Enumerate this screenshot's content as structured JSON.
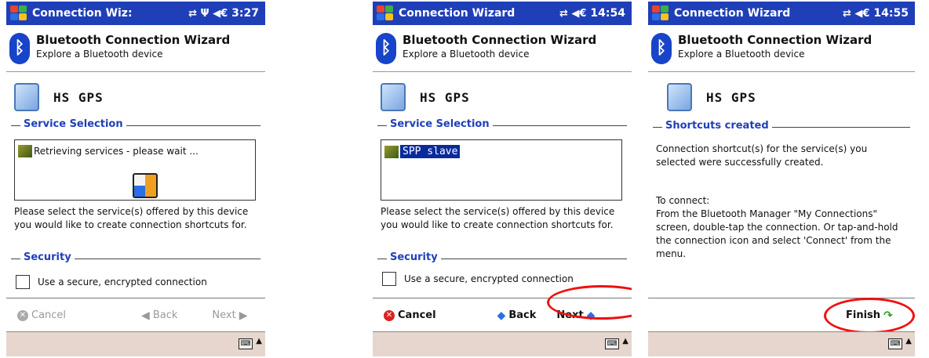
{
  "screens": [
    {
      "titlebar": {
        "title": "Connection Wiz:",
        "icons": "⇄ Ψ ◀€",
        "time": "3:27"
      },
      "header": {
        "title": "Bluetooth Connection Wizard",
        "subtitle": "Explore a Bluetooth device"
      },
      "device_name": "HS  GPS",
      "section1": "Service Selection",
      "list_text": "Retrieving services - please wait ...",
      "description": "Please select the service(s) offered by this device you would like to create connection shortcuts for.",
      "section2": "Security",
      "checkbox_label": "Use a secure, encrypted connection",
      "cancel_label": "Cancel",
      "back_label": "Back",
      "next_label": "Next"
    },
    {
      "titlebar": {
        "title": "Connection Wizard",
        "icons": "⇄ ◀€",
        "time": "14:54"
      },
      "header": {
        "title": "Bluetooth Connection Wizard",
        "subtitle": "Explore a Bluetooth device"
      },
      "device_name": "HS  GPS",
      "section1": "Service Selection",
      "list_text": "SPP slave",
      "description": "Please select the service(s) offered by this device you would like to create connection shortcuts for.",
      "section2": "Security",
      "checkbox_label": "Use a secure, encrypted connection",
      "cancel_label": "Cancel",
      "back_label": "Back",
      "next_label": "Next"
    },
    {
      "titlebar": {
        "title": "Connection Wizard",
        "icons": "⇄ ◀€",
        "time": "14:55"
      },
      "header": {
        "title": "Bluetooth Connection Wizard",
        "subtitle": "Explore a Bluetooth device"
      },
      "device_name": "HS  GPS",
      "section1": "Shortcuts created",
      "text1": "Connection shortcut(s)  for the service(s) you selected were successfully created.",
      "text2": "To connect:\nFrom the Bluetooth Manager \"My Connections\" screen, double-tap the connection. Or tap-and-hold the connection icon and select 'Connect' from the menu.",
      "finish_label": "Finish"
    }
  ]
}
